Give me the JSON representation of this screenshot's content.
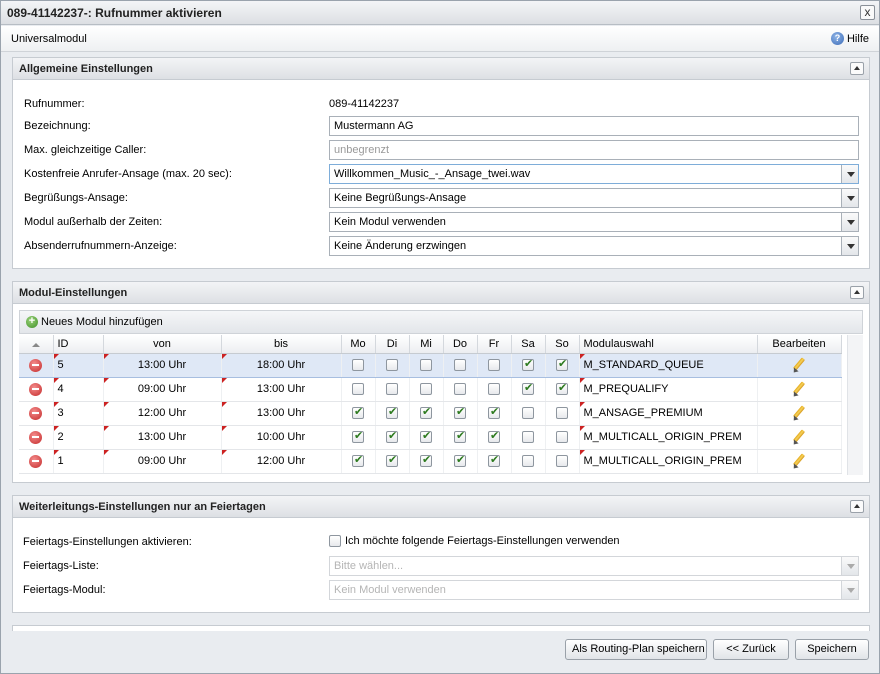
{
  "window": {
    "title": "089-41142237-: Rufnummer aktivieren",
    "close_label": "x"
  },
  "module_bar": {
    "title": "Universalmodul",
    "help_label": "Hilfe"
  },
  "general": {
    "title": "Allgemeine Einstellungen",
    "fields": {
      "rufnummer_label": "Rufnummer:",
      "rufnummer_value": "089-41142237",
      "bezeichnung_label": "Bezeichnung:",
      "bezeichnung_value": "Mustermann AG",
      "max_caller_label": "Max. gleichzeitige Caller:",
      "max_caller_placeholder": "unbegrenzt",
      "ansage_label": "Kostenfreie Anrufer-Ansage (max. 20 sec):",
      "ansage_value": "Willkommen_Music_-_Ansage_twei.wav",
      "begruessung_label": "Begrüßungs-Ansage:",
      "begruessung_value": "Keine Begrüßungs-Ansage",
      "ausserhalb_label": "Modul außerhalb der Zeiten:",
      "ausserhalb_value": "Kein Modul verwenden",
      "absender_label": "Absenderrufnummern-Anzeige:",
      "absender_value": "Keine Änderung erzwingen"
    }
  },
  "modules": {
    "title": "Modul-Einstellungen",
    "add_label": "Neues Modul hinzufügen",
    "columns": {
      "id": "ID",
      "von": "von",
      "bis": "bis",
      "mo": "Mo",
      "di": "Di",
      "mi": "Mi",
      "do": "Do",
      "fr": "Fr",
      "sa": "Sa",
      "so": "So",
      "modul": "Modulauswahl",
      "edit": "Bearbeiten"
    },
    "rows": [
      {
        "id": "5",
        "von": "13:00 Uhr",
        "bis": "18:00 Uhr",
        "days": [
          false,
          false,
          false,
          false,
          false,
          true,
          true
        ],
        "modul": "M_STANDARD_QUEUE",
        "selected": true
      },
      {
        "id": "4",
        "von": "09:00 Uhr",
        "bis": "13:00 Uhr",
        "days": [
          false,
          false,
          false,
          false,
          false,
          true,
          true
        ],
        "modul": "M_PREQUALIFY",
        "selected": false
      },
      {
        "id": "3",
        "von": "12:00 Uhr",
        "bis": "13:00 Uhr",
        "days": [
          true,
          true,
          true,
          true,
          true,
          false,
          false
        ],
        "modul": "M_ANSAGE_PREMIUM",
        "selected": false
      },
      {
        "id": "2",
        "von": "13:00 Uhr",
        "bis": "10:00 Uhr",
        "days": [
          true,
          true,
          true,
          true,
          true,
          false,
          false
        ],
        "modul": "M_MULTICALL_ORIGIN_PREM",
        "selected": false
      },
      {
        "id": "1",
        "von": "09:00 Uhr",
        "bis": "12:00 Uhr",
        "days": [
          true,
          true,
          true,
          true,
          true,
          false,
          false
        ],
        "modul": "M_MULTICALL_ORIGIN_PREM",
        "selected": false
      }
    ]
  },
  "holidays": {
    "title": "Weiterleitungs-Einstellungen nur an Feiertagen",
    "activate_label": "Feiertags-Einstellungen aktivieren:",
    "activate_checkbox_label": "Ich möchte folgende Feiertags-Einstellungen verwenden",
    "liste_label": "Feiertags-Liste:",
    "liste_placeholder": "Bitte wählen...",
    "modul_label": "Feiertags-Modul:",
    "modul_value": "Kein Modul verwenden"
  },
  "footer": {
    "save_routing_label": "Als Routing-Plan speichern",
    "back_label": "<< Zurück",
    "save_label": "Speichern"
  }
}
